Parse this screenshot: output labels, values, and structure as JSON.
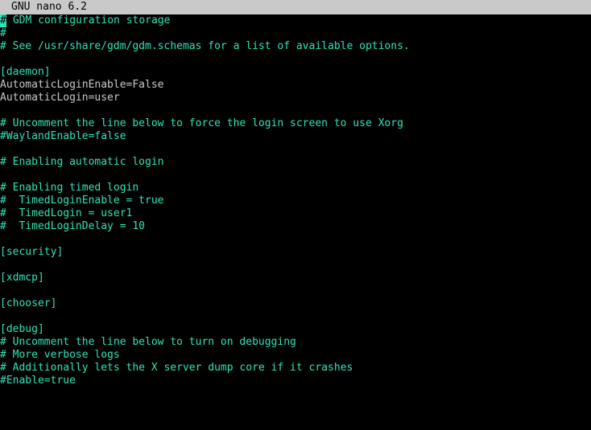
{
  "titlebar": {
    "app": "GNU nano 6.2"
  },
  "cursor_char": "#",
  "lines": [
    {
      "cursor": true,
      "cls": "comment",
      "text": " GDM configuration storage"
    },
    {
      "cls": "comment",
      "text": "#"
    },
    {
      "cls": "comment",
      "text": "# See /usr/share/gdm/gdm.schemas for a list of available options."
    },
    {
      "cls": "plain",
      "text": ""
    },
    {
      "cls": "comment",
      "text": "[daemon]"
    },
    {
      "cls": "plain",
      "text": "AutomaticLoginEnable=False"
    },
    {
      "cls": "plain",
      "text": "AutomaticLogin=user"
    },
    {
      "cls": "plain",
      "text": ""
    },
    {
      "cls": "comment",
      "text": "# Uncomment the line below to force the login screen to use Xorg"
    },
    {
      "cls": "comment",
      "text": "#WaylandEnable=false"
    },
    {
      "cls": "plain",
      "text": ""
    },
    {
      "cls": "comment",
      "text": "# Enabling automatic login"
    },
    {
      "cls": "plain",
      "text": ""
    },
    {
      "cls": "comment",
      "text": "# Enabling timed login"
    },
    {
      "cls": "comment",
      "text": "#  TimedLoginEnable = true"
    },
    {
      "cls": "comment",
      "text": "#  TimedLogin = user1"
    },
    {
      "cls": "comment",
      "text": "#  TimedLoginDelay = 10"
    },
    {
      "cls": "plain",
      "text": ""
    },
    {
      "cls": "comment",
      "text": "[security]"
    },
    {
      "cls": "plain",
      "text": ""
    },
    {
      "cls": "comment",
      "text": "[xdmcp]"
    },
    {
      "cls": "plain",
      "text": ""
    },
    {
      "cls": "comment",
      "text": "[chooser]"
    },
    {
      "cls": "plain",
      "text": ""
    },
    {
      "cls": "comment",
      "text": "[debug]"
    },
    {
      "cls": "comment",
      "text": "# Uncomment the line below to turn on debugging"
    },
    {
      "cls": "comment",
      "text": "# More verbose logs"
    },
    {
      "cls": "comment",
      "text": "# Additionally lets the X server dump core if it crashes"
    },
    {
      "cls": "comment",
      "text": "#Enable=true"
    }
  ]
}
